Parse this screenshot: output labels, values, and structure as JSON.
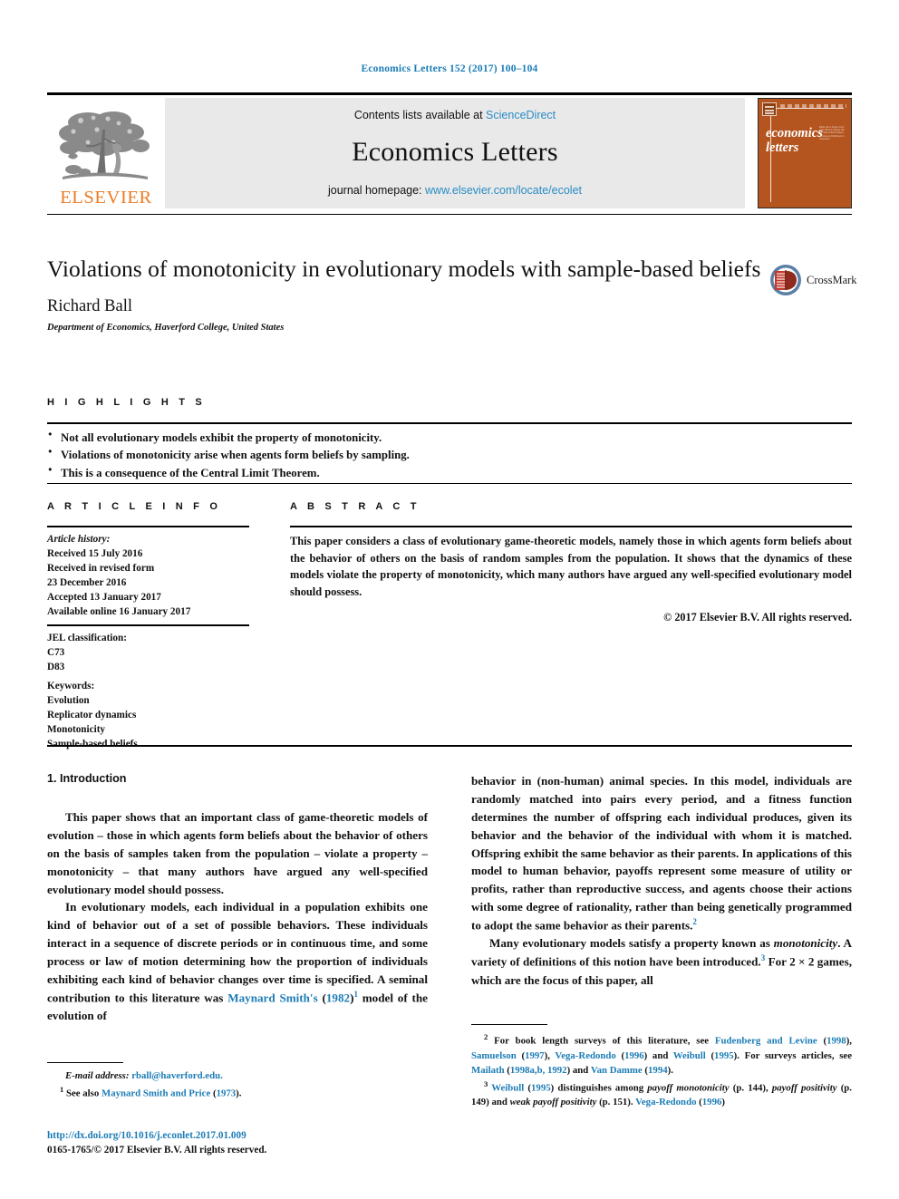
{
  "running_head": "Economics Letters 152 (2017) 100–104",
  "masthead": {
    "publisher_word": "ELSEVIER",
    "contents_prefix": "Contents lists available at ",
    "contents_link": "ScienceDirect",
    "journal_title": "Economics Letters",
    "homepage_prefix": "journal homepage: ",
    "homepage_link": "www.elsevier.com/locate/ecolet",
    "cover_word_line1": "economics",
    "cover_word_line2": "letters",
    "cover_toc_filler": "Editor Aims Scope Contents Volume Papers Notes Index Authors Elsevier Science Publishers Amsterdam"
  },
  "article": {
    "title": "Violations of monotonicity in evolutionary models with sample-based beliefs",
    "author": "Richard Ball",
    "affiliation": "Department of Economics, Haverford College, United States",
    "crossmark_label": "CrossMark"
  },
  "highlights": {
    "heading": "H I G H L I G H T S",
    "items": [
      "Not all evolutionary models exhibit the property of monotonicity.",
      "Violations of monotonicity arise when agents form beliefs by sampling.",
      "This is a consequence of the Central Limit Theorem."
    ]
  },
  "article_info": {
    "heading": "A R T I C L E   I N F O",
    "history_label": "Article history:",
    "history": [
      "Received 15 July 2016",
      "Received in revised form",
      "23 December 2016",
      "Accepted 13 January 2017",
      "Available online 16 January 2017"
    ],
    "jel_label": "JEL classification:",
    "jel": [
      "C73",
      "D83"
    ],
    "keywords_label": "Keywords:",
    "keywords": [
      "Evolution",
      "Replicator dynamics",
      "Monotonicity",
      "Sample-based beliefs"
    ]
  },
  "abstract": {
    "heading": "A B S T R A C T",
    "text": "This paper considers a class of evolutionary game-theoretic models, namely those in which agents form beliefs about the behavior of others on the basis of random samples from the population. It shows that the dynamics of these models violate the property of monotonicity, which many authors have argued any well-specified evolutionary model should possess.",
    "copyright": "© 2017 Elsevier B.V. All rights reserved."
  },
  "body": {
    "section_title": "1. Introduction",
    "p1_a": "This paper shows that an important class of game-theoretic models of evolution – those in which agents form beliefs about the behavior of others on the basis of samples taken from the population – violate a property – monotonicity – that many authors have argued any well-specified evolutionary model should possess.",
    "p2_a": "In evolutionary models, each individual in a population exhibits one kind of behavior out of a set of possible behaviors. These individuals interact in a sequence of discrete periods or in continuous time, and some process or law of motion determining how the proportion of individuals exhibiting each kind of behavior changes over time is specified. A seminal contribution to this literature was ",
    "p2_cite": "Maynard Smith's",
    "p2_b": " (",
    "p2_year": "1982",
    "p2_c": ")",
    "p2_fn": "1",
    "p2_d": " model of the evolution of",
    "p3_a": "behavior in (non-human) animal species. In this model, individuals are randomly matched into pairs every period, and a fitness function determines the number of offspring each individual produces, given its behavior and the behavior of the individual with whom it is matched. Offspring exhibit the same behavior as their parents. In applications of this model to human behavior, payoffs represent some measure of utility or profits, rather than reproductive success, and agents choose their actions with some degree of rationality, rather than being genetically programmed to adopt the same behavior as their parents.",
    "p3_fn": "2",
    "p4_a": "Many evolutionary models satisfy a property known as ",
    "p4_it": "monotonicity",
    "p4_b": ". A variety of definitions of this notion have been introduced.",
    "p4_fn": "3",
    "p4_c": " For 2 × 2 games, which are the focus of this paper, all"
  },
  "footnotes": {
    "email_label": "E-mail address:",
    "email": "rball@haverford.edu.",
    "fn1_num": "1",
    "fn1_a": "See also ",
    "fn1_cite": "Maynard Smith and Price",
    "fn1_b": " (",
    "fn1_year": "1973",
    "fn1_c": ").",
    "fn2_num": "2",
    "fn2_a": "For book length surveys of this literature, see ",
    "fn2_c1": "Fudenberg and Levine",
    "fn2_y1": "1998",
    "fn2_c2": "Samuelson",
    "fn2_y2": "1997",
    "fn2_c3": "Vega-Redondo",
    "fn2_y3": "1996",
    "fn2_c4": "Weibull",
    "fn2_y4": "1995",
    "fn2_mid": ". For surveys articles, see ",
    "fn2_c5": "Mailath",
    "fn2_y5": "1998a,b, 1992",
    "fn2_and": " and ",
    "fn2_c6": "Van Damme",
    "fn2_y6": "1994",
    "fn3_num": "3",
    "fn3_c1": "Weibull",
    "fn3_y1": "1995",
    "fn3_a": " distinguishes among ",
    "fn3_it1": "payoff monotonicity",
    "fn3_p1": " (p. 144), ",
    "fn3_it2": "payoff positivity",
    "fn3_p2": " (p. 149) and ",
    "fn3_it3": "weak payoff positivity",
    "fn3_p3": " (p. 151). ",
    "fn3_c2": "Vega-Redondo",
    "fn3_y2": "1996"
  },
  "imprint": {
    "doi": "http://dx.doi.org/10.1016/j.econlet.2017.01.009",
    "issn_line": "0165-1765/© 2017 Elsevier B.V. All rights reserved."
  },
  "colors": {
    "link_blue": "#1b7cb5",
    "masthead_grey": "#e9e9e9",
    "elsevier_orange": "#ec7b25",
    "cover_brown": "#b4541f"
  }
}
